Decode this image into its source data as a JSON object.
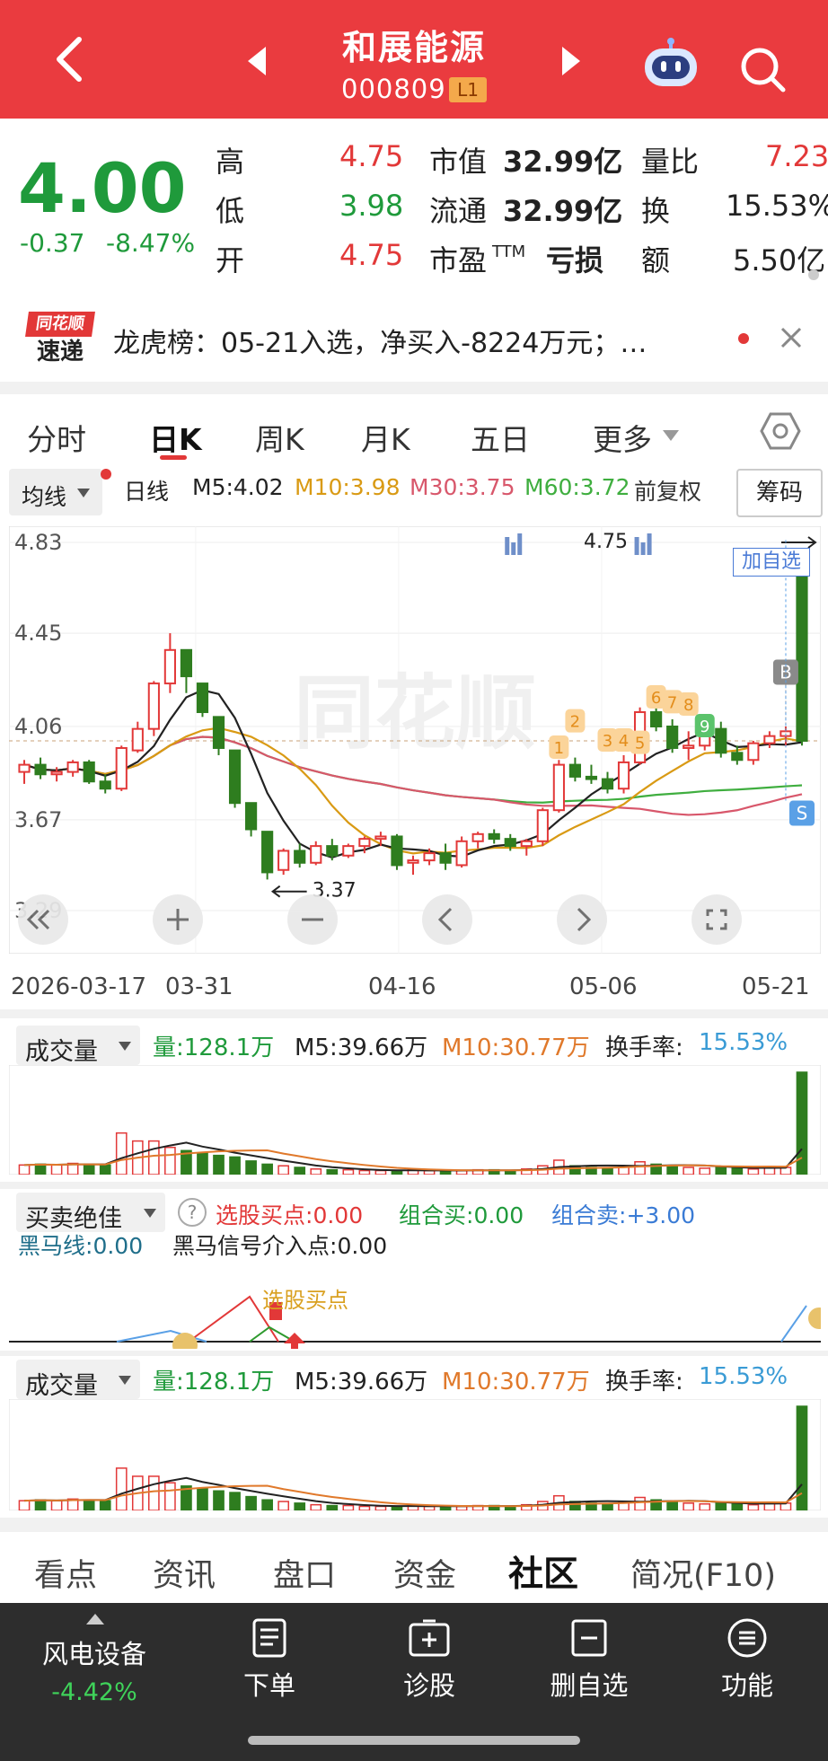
{
  "header": {
    "title": "和展能源",
    "code": "000809",
    "level": "L1"
  },
  "quote": {
    "price": "4.00",
    "change": "-0.37",
    "change_pct": "-8.47%",
    "high_label": "高",
    "high": "4.75",
    "low_label": "低",
    "low": "3.98",
    "open_label": "开",
    "open": "4.75",
    "mcap_label": "市值",
    "mcap": "32.99亿",
    "float_label": "流通",
    "float": "32.99亿",
    "pe_label": "市盈",
    "pe_sup": "TTM",
    "pe": "亏损",
    "volratio_label": "量比",
    "volratio": "7.23",
    "turnover_label": "换",
    "turnover": "15.53%",
    "amount_label": "额",
    "amount": "5.50亿"
  },
  "news": {
    "logo_top": "同花顺",
    "logo_bottom": "速递",
    "text": "龙虎榜：05-21入选，净买入-8224万元；…"
  },
  "tabs": {
    "items": [
      "分时",
      "日K",
      "周K",
      "月K",
      "五日",
      "更多"
    ],
    "active": "日K"
  },
  "ma_bar": {
    "selector": "均线",
    "period": "日线",
    "m5": "M5:4.02",
    "m10": "M10:3.98",
    "m30": "M30:3.75",
    "m60": "M60:3.72",
    "adjust": "前复权",
    "chip": "筹码",
    "colors": {
      "m5": "#222222",
      "m10": "#d99a14",
      "m30": "#d8576b",
      "m60": "#3fae3f"
    }
  },
  "kline": {
    "y_ticks": [
      "4.83",
      "4.45",
      "4.06",
      "3.67",
      "3.29"
    ],
    "high_label": "4.75",
    "low_label": "3.37",
    "add_watch": "加自选",
    "dates": [
      "2026-03-17",
      "03-31",
      "04-16",
      "05-06",
      "05-21"
    ],
    "buy_marker": "B",
    "sell_marker": "S",
    "seq_markers": [
      "1",
      "2",
      "3",
      "4",
      "5",
      "6",
      "7",
      "8",
      "9"
    ],
    "watermark": "同花顺",
    "chart_data": {
      "type": "candlestick",
      "up_color": "#e23838",
      "down_color": "#2e7d1f",
      "candles": [
        [
          3.87,
          3.92,
          3.82,
          3.9
        ],
        [
          3.9,
          3.93,
          3.84,
          3.86
        ],
        [
          3.86,
          3.89,
          3.83,
          3.87
        ],
        [
          3.87,
          3.92,
          3.85,
          3.91
        ],
        [
          3.91,
          3.92,
          3.82,
          3.83
        ],
        [
          3.83,
          3.86,
          3.78,
          3.8
        ],
        [
          3.8,
          3.98,
          3.79,
          3.97
        ],
        [
          3.96,
          4.08,
          3.95,
          4.05
        ],
        [
          4.05,
          4.25,
          4.02,
          4.24
        ],
        [
          4.24,
          4.45,
          4.2,
          4.38
        ],
        [
          4.38,
          4.3,
          4.2,
          4.27
        ],
        [
          4.24,
          4.16,
          4.1,
          4.12
        ],
        [
          4.1,
          4.09,
          3.94,
          3.97
        ],
        [
          3.96,
          3.9,
          3.72,
          3.74
        ],
        [
          3.74,
          3.72,
          3.6,
          3.63
        ],
        [
          3.62,
          3.58,
          3.42,
          3.45
        ],
        [
          3.46,
          3.55,
          3.44,
          3.54
        ],
        [
          3.54,
          3.57,
          3.47,
          3.49
        ],
        [
          3.49,
          3.58,
          3.48,
          3.56
        ],
        [
          3.56,
          3.59,
          3.5,
          3.52
        ],
        [
          3.52,
          3.57,
          3.51,
          3.56
        ],
        [
          3.56,
          3.6,
          3.53,
          3.59
        ],
        [
          3.59,
          3.62,
          3.56,
          3.6
        ],
        [
          3.6,
          3.61,
          3.46,
          3.48
        ],
        [
          3.49,
          3.52,
          3.44,
          3.5
        ],
        [
          3.5,
          3.55,
          3.48,
          3.53
        ],
        [
          3.53,
          3.57,
          3.46,
          3.49
        ],
        [
          3.48,
          3.6,
          3.47,
          3.58
        ],
        [
          3.58,
          3.62,
          3.55,
          3.61
        ],
        [
          3.61,
          3.63,
          3.57,
          3.59
        ],
        [
          3.59,
          3.61,
          3.54,
          3.56
        ],
        [
          3.56,
          3.59,
          3.52,
          3.58
        ],
        [
          3.58,
          3.72,
          3.56,
          3.71
        ],
        [
          3.71,
          3.92,
          3.7,
          3.9
        ],
        [
          3.9,
          3.93,
          3.83,
          3.85
        ],
        [
          3.85,
          3.9,
          3.82,
          3.84
        ],
        [
          3.84,
          3.87,
          3.78,
          3.8
        ],
        [
          3.8,
          3.94,
          3.78,
          3.91
        ],
        [
          3.91,
          4.14,
          3.9,
          4.12
        ],
        [
          4.12,
          4.15,
          4.04,
          4.06
        ],
        [
          4.06,
          4.09,
          3.95,
          3.97
        ],
        [
          3.97,
          4.04,
          3.92,
          3.98
        ],
        [
          3.98,
          4.07,
          3.96,
          4.05
        ],
        [
          4.05,
          4.08,
          3.93,
          3.95
        ],
        [
          3.95,
          3.98,
          3.9,
          3.92
        ],
        [
          3.92,
          4.0,
          3.9,
          3.99
        ],
        [
          3.99,
          4.04,
          3.97,
          4.02
        ],
        [
          4.02,
          4.06,
          3.98,
          4.04
        ],
        [
          4.75,
          4.75,
          3.98,
          4.0
        ]
      ]
    }
  },
  "vol1": {
    "selector": "成交量",
    "vol": "量:128.1万",
    "m5": "M5:39.66万",
    "m10": "M10:30.77万",
    "turnover_label": "换手率:",
    "turnover": "15.53%",
    "chart_data": {
      "type": "bar",
      "values": [
        12,
        13,
        12,
        14,
        13,
        12,
        52,
        42,
        42,
        34,
        30,
        27,
        24,
        22,
        17,
        13,
        11,
        9,
        7,
        6,
        6,
        5,
        5,
        5,
        6,
        5,
        5,
        5,
        6,
        6,
        5,
        7,
        11,
        18,
        11,
        9,
        8,
        10,
        16,
        13,
        11,
        9,
        8,
        10,
        8,
        7,
        9,
        9,
        128
      ]
    }
  },
  "signal": {
    "selector": "买卖绝佳",
    "a_label": "选股买点:",
    "a": "0.00",
    "b_label": "组合买:",
    "b": "0.00",
    "c_label": "组合卖:",
    "c": "+3.00",
    "d_label": "黑马线:",
    "d": "0.00",
    "e_label": "黑马信号介入点:",
    "e": "0.00",
    "annot": "选股买点"
  },
  "vol2": {
    "selector": "成交量",
    "vol": "量:128.1万",
    "m5": "M5:39.66万",
    "m10": "M10:30.77万",
    "turnover_label": "换手率:",
    "turnover": "15.53%"
  },
  "bottom_tabs": {
    "items": [
      "看点",
      "资讯",
      "盘口",
      "资金",
      "社区",
      "简况(F10)"
    ],
    "active": "社区"
  },
  "footer": {
    "sector": "风电设备",
    "sector_change": "-4.42%",
    "items": [
      {
        "label": "下单",
        "icon": "doc-icon"
      },
      {
        "label": "诊股",
        "icon": "plus-box-icon"
      },
      {
        "label": "删自选",
        "icon": "minus-box-icon"
      },
      {
        "label": "功能",
        "icon": "menu-icon"
      }
    ]
  }
}
